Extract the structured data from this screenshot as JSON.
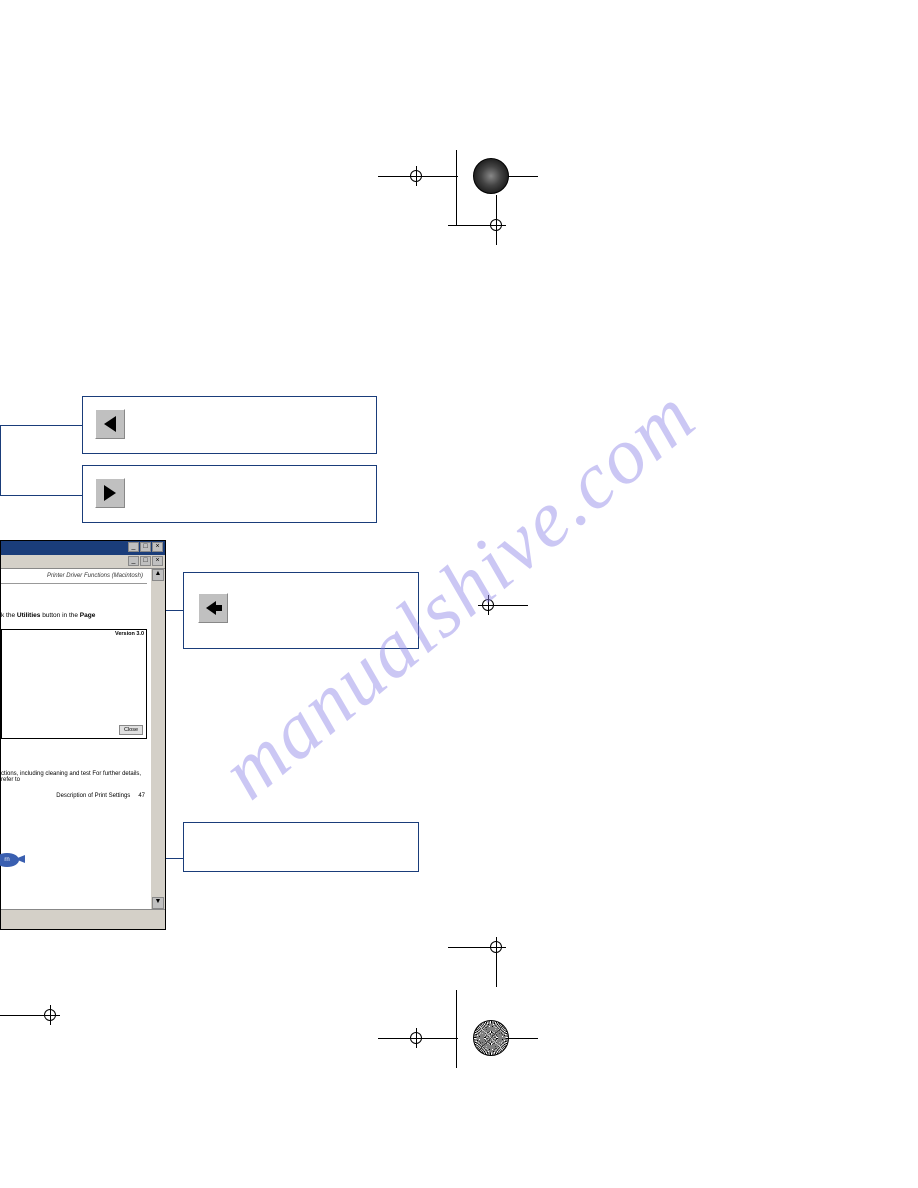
{
  "watermark": "manualshive.com",
  "acrobat": {
    "header": "Printer Driver Functions (Macintosh)",
    "text1_prefix": "k the ",
    "text1_bold1": "Utilities",
    "text1_mid": " button in the ",
    "text1_bold2": "Page",
    "inner_title": "Version 3.0",
    "inner_btn": "Close",
    "text2": "ctions, including cleaning and test For further details, refer to",
    "return_label": "rn",
    "footer_text": "Description of Print Settings",
    "page_num": "47"
  },
  "win_controls": {
    "min": "_",
    "max": "□",
    "close": "×",
    "up": "▲",
    "down": "▼"
  }
}
